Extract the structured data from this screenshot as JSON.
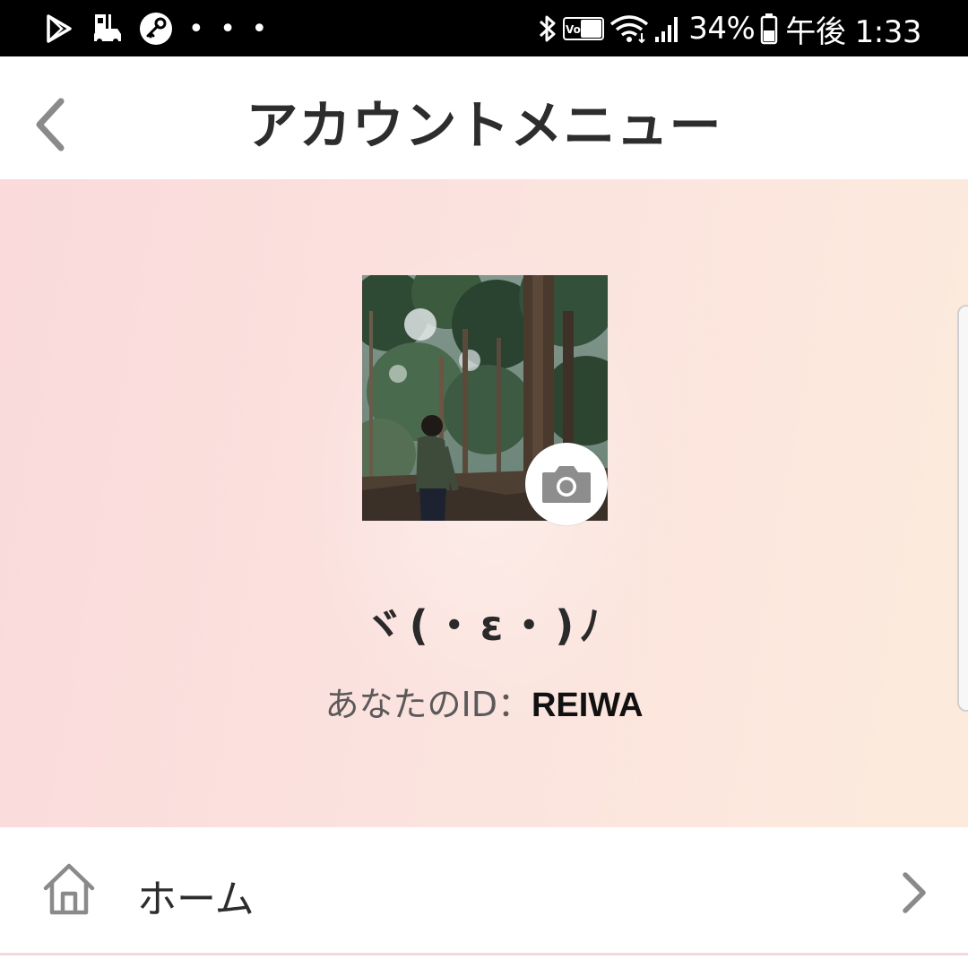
{
  "status_bar": {
    "icons_left": [
      "play-store-icon",
      "parking-icon",
      "key-icon"
    ],
    "more": "• • •",
    "icons_right": [
      "bluetooth-icon",
      "volte-icon",
      "wifi-icon",
      "signal-icon",
      "battery-icon"
    ],
    "volte_label": "VoLTE",
    "battery": "34%",
    "time": "午後 1:33"
  },
  "header": {
    "title": "アカウントメニュー",
    "back_icon": "chevron-left-icon"
  },
  "profile": {
    "display_name": "ヾ(・ε・)ﾉ",
    "id_label": "あなたのID：",
    "id_value": "REIWA",
    "camera_icon": "camera-icon"
  },
  "menu": {
    "items": [
      {
        "icon": "home-icon",
        "label": "ホーム",
        "chevron": "chevron-right-icon"
      }
    ]
  },
  "colors": {
    "status_bar_bg": "#000000",
    "header_bg": "#ffffff",
    "profile_gradient_start": "#fadadb",
    "profile_gradient_end": "#fcebdd",
    "title_text": "#2d2d2d",
    "icon_gray": "#8a8a8a"
  }
}
